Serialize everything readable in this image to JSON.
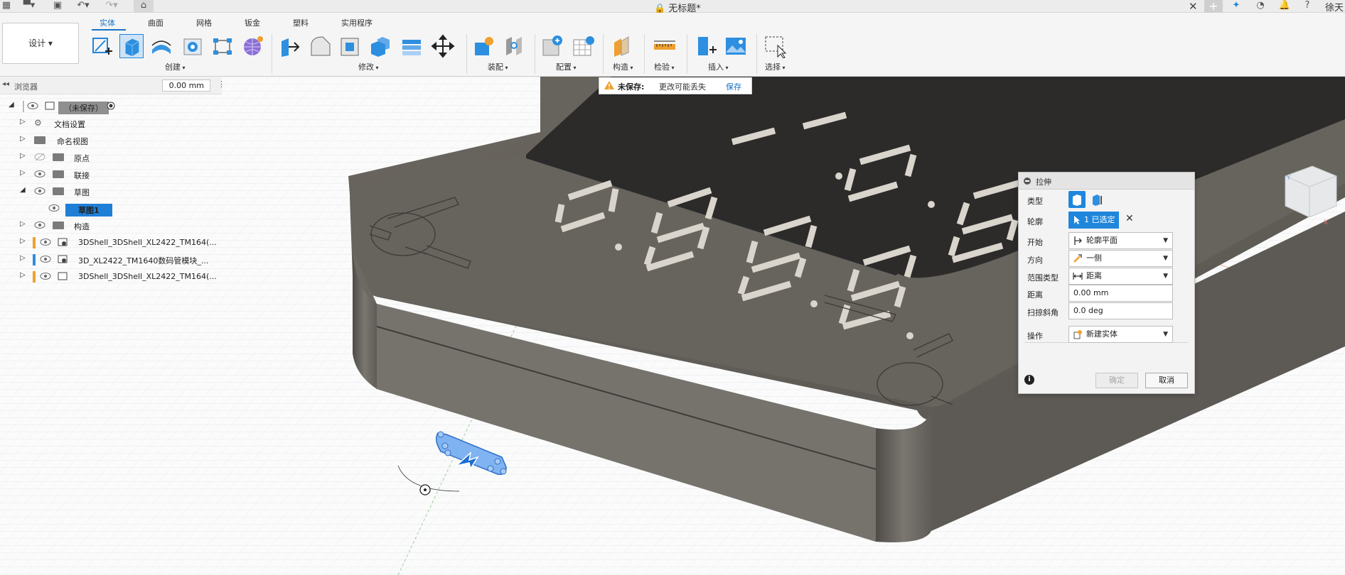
{
  "app": {
    "document_title": "无标题*",
    "user_name": "徐天"
  },
  "ribbon": {
    "design_label": "设计 ▾",
    "tabs": [
      {
        "label": "实体",
        "active": true
      },
      {
        "label": "曲面",
        "active": false
      },
      {
        "label": "网格",
        "active": false
      },
      {
        "label": "钣金",
        "active": false
      },
      {
        "label": "塑料",
        "active": false
      },
      {
        "label": "实用程序",
        "active": false
      }
    ],
    "groups": {
      "create": "创建",
      "modify": "修改",
      "assemble": "装配",
      "configure": "配置",
      "construct": "构造",
      "inspect": "检验",
      "insert": "插入",
      "select": "选择"
    }
  },
  "browser": {
    "title": "浏览器",
    "value": "0.00 mm",
    "root": "（未保存）",
    "items": [
      {
        "label": "文档设置"
      },
      {
        "label": "命名视图"
      },
      {
        "label": "原点"
      },
      {
        "label": "联接"
      },
      {
        "label": "草图"
      },
      {
        "label": "草图1"
      },
      {
        "label": "构造"
      },
      {
        "label": "3DShell_3DShell_XL2422_TM164(..."
      },
      {
        "label": "3D_XL2422_TM1640数码管模块_..."
      },
      {
        "label": "3DShell_3DShell_XL2422_TM164(..."
      }
    ]
  },
  "notice": {
    "title": "未保存:",
    "message": "更改可能丢失",
    "action": "保存"
  },
  "dialog": {
    "title": "拉伸",
    "type_label": "类型",
    "profile_label": "轮廓",
    "profile_value": "1 已选定",
    "start_label": "开始",
    "start_value": "轮廓平面",
    "direction_label": "方向",
    "direction_value": "一侧",
    "extent_label": "范围类型",
    "extent_value": "距离",
    "distance_label": "距离",
    "distance_value": "0.00 mm",
    "taper_label": "扫掠斜角",
    "taper_value": "0.0 deg",
    "operation_label": "操作",
    "operation_value": "新建实体",
    "ok_label": "确定",
    "cancel_label": "取消"
  },
  "colors": {
    "accent": "#1f86dc",
    "tab_active": "#1773c6",
    "component_orange": "#f0a030",
    "component_blue": "#2d8fe0"
  }
}
